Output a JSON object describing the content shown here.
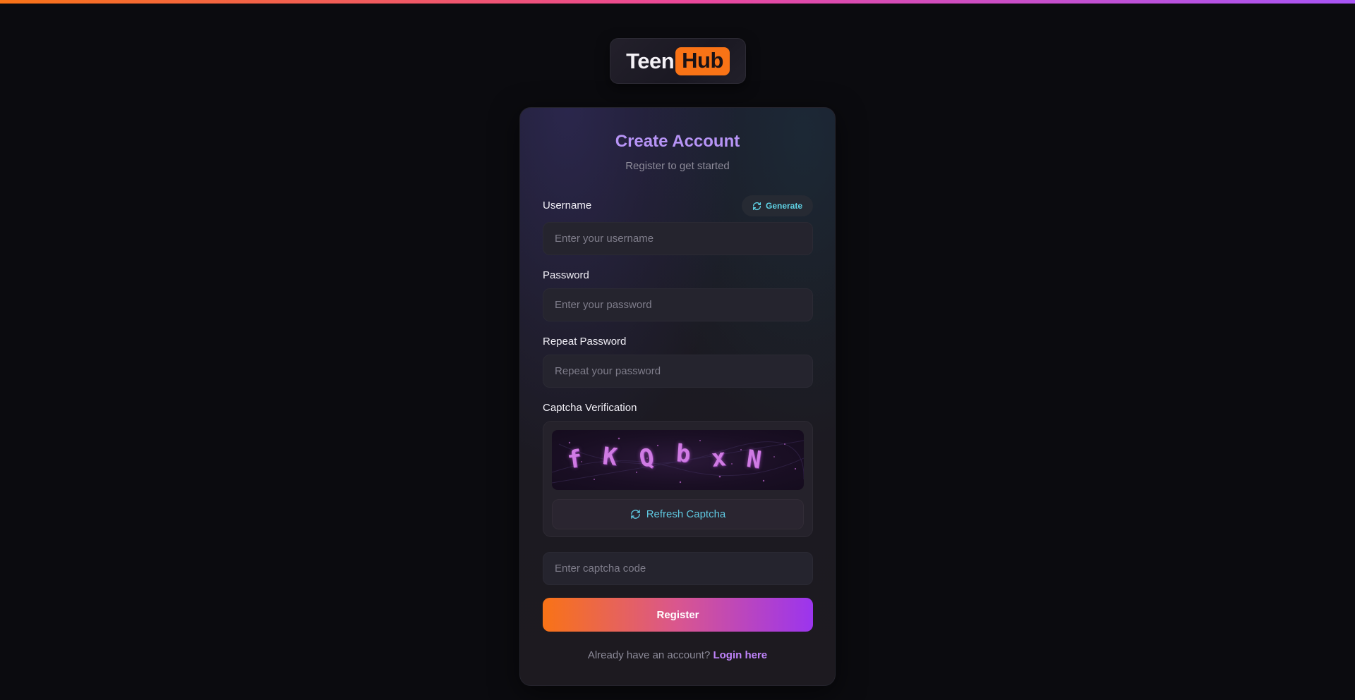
{
  "brand": {
    "logo_part1": "Teen",
    "logo_part2": "Hub",
    "accent": "#f97316"
  },
  "form": {
    "title": "Create Account",
    "subtitle": "Register to get started",
    "username": {
      "label": "Username",
      "placeholder": "Enter your username",
      "value": ""
    },
    "generate_label": "Generate",
    "password": {
      "label": "Password",
      "placeholder": "Enter your password",
      "value": ""
    },
    "repeat_password": {
      "label": "Repeat Password",
      "placeholder": "Repeat your password",
      "value": ""
    },
    "captcha": {
      "label": "Captcha Verification",
      "chars": [
        "f",
        "K",
        "Q",
        "b",
        "x",
        "N"
      ],
      "refresh_label": "Refresh Captcha",
      "input_placeholder": "Enter captcha code",
      "value": ""
    },
    "register_label": "Register",
    "footer_prompt": "Already have an account?",
    "login_link": "Login here"
  },
  "icons": {
    "generate": "refresh-icon",
    "refresh": "refresh-icon"
  },
  "colors": {
    "title": "#b794f6",
    "link": "#c084fc",
    "cyan": "#5fd3e6"
  }
}
